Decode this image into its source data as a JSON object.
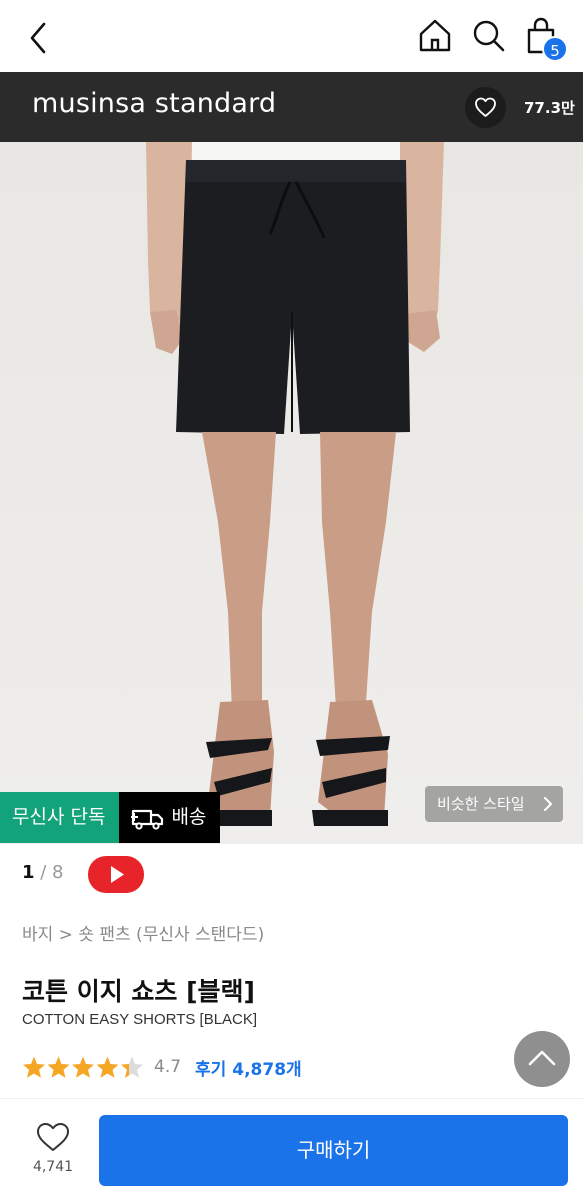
{
  "header": {
    "back_icon": "chevron-left-icon",
    "home_icon": "home-icon",
    "search_icon": "search-icon",
    "cart_icon": "shopping-bag-icon",
    "cart_count": "5"
  },
  "brand": {
    "name": "musinsa standard",
    "like_icon": "heart-icon",
    "like_count": "77.3만"
  },
  "gallery": {
    "current": "1",
    "total": "/ 8",
    "video_icon": "youtube-play-icon",
    "exclusive_label": "무신사 단독",
    "delivery_label": "배송",
    "delivery_icon": "truck-icon",
    "similar_style_label": "비슷한 스타일"
  },
  "product": {
    "breadcrumb": "바지 > 숏 팬츠 (무신사 스탠다드)",
    "title": "코튼 이지 쇼츠 [블랙]",
    "subtitle": "COTTON EASY SHORTS [BLACK]",
    "rating_value": 4.7,
    "rating_text": "4.7",
    "reviews_label": "후기 4,878개"
  },
  "footer": {
    "wish_count": "4,741",
    "buy_label": "구매하기"
  },
  "colors": {
    "accent": "#1a73e8",
    "exclusive_green": "#12a37a",
    "brand_bar": "#2b2b2b",
    "star": "#f5a623",
    "youtube_red": "#e8242b"
  }
}
